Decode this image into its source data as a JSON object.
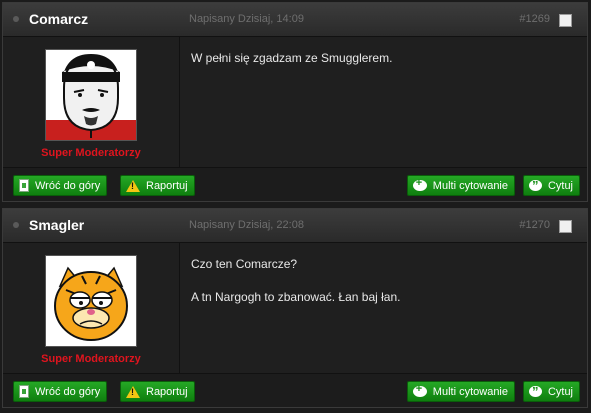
{
  "posts": [
    {
      "author": "Comarcz",
      "date": "Napisany Dzisiaj, 14:09",
      "number": "#1269",
      "rank": "Super Moderatorzy",
      "rank_color": "#e0141e",
      "avatar_icon": "tough-guy-face-avatar",
      "content": [
        "W pełni się zgadzam ze Smugglerem."
      ],
      "buttons": {
        "back_to_top": "Wróć do góry",
        "report": "Raportuj",
        "multi_quote": "Multi cytowanie",
        "quote": "Cytuj"
      }
    },
    {
      "author": "Smagler",
      "date": "Napisany Dzisiaj, 22:08",
      "number": "#1270",
      "rank": "Super Moderatorzy",
      "rank_color": "#e0141e",
      "avatar_icon": "garfield-face-avatar",
      "content": [
        "Czo ten Comarcze?",
        "A tn Nargogh to zbanować. Łan baj łan."
      ],
      "buttons": {
        "back_to_top": "Wróć do góry",
        "report": "Raportuj",
        "multi_quote": "Multi cytowanie",
        "quote": "Cytuj"
      }
    }
  ],
  "colors": {
    "button_green": "#18961a",
    "header_bg": "#333333",
    "body_bg": "#1f1f1f"
  }
}
